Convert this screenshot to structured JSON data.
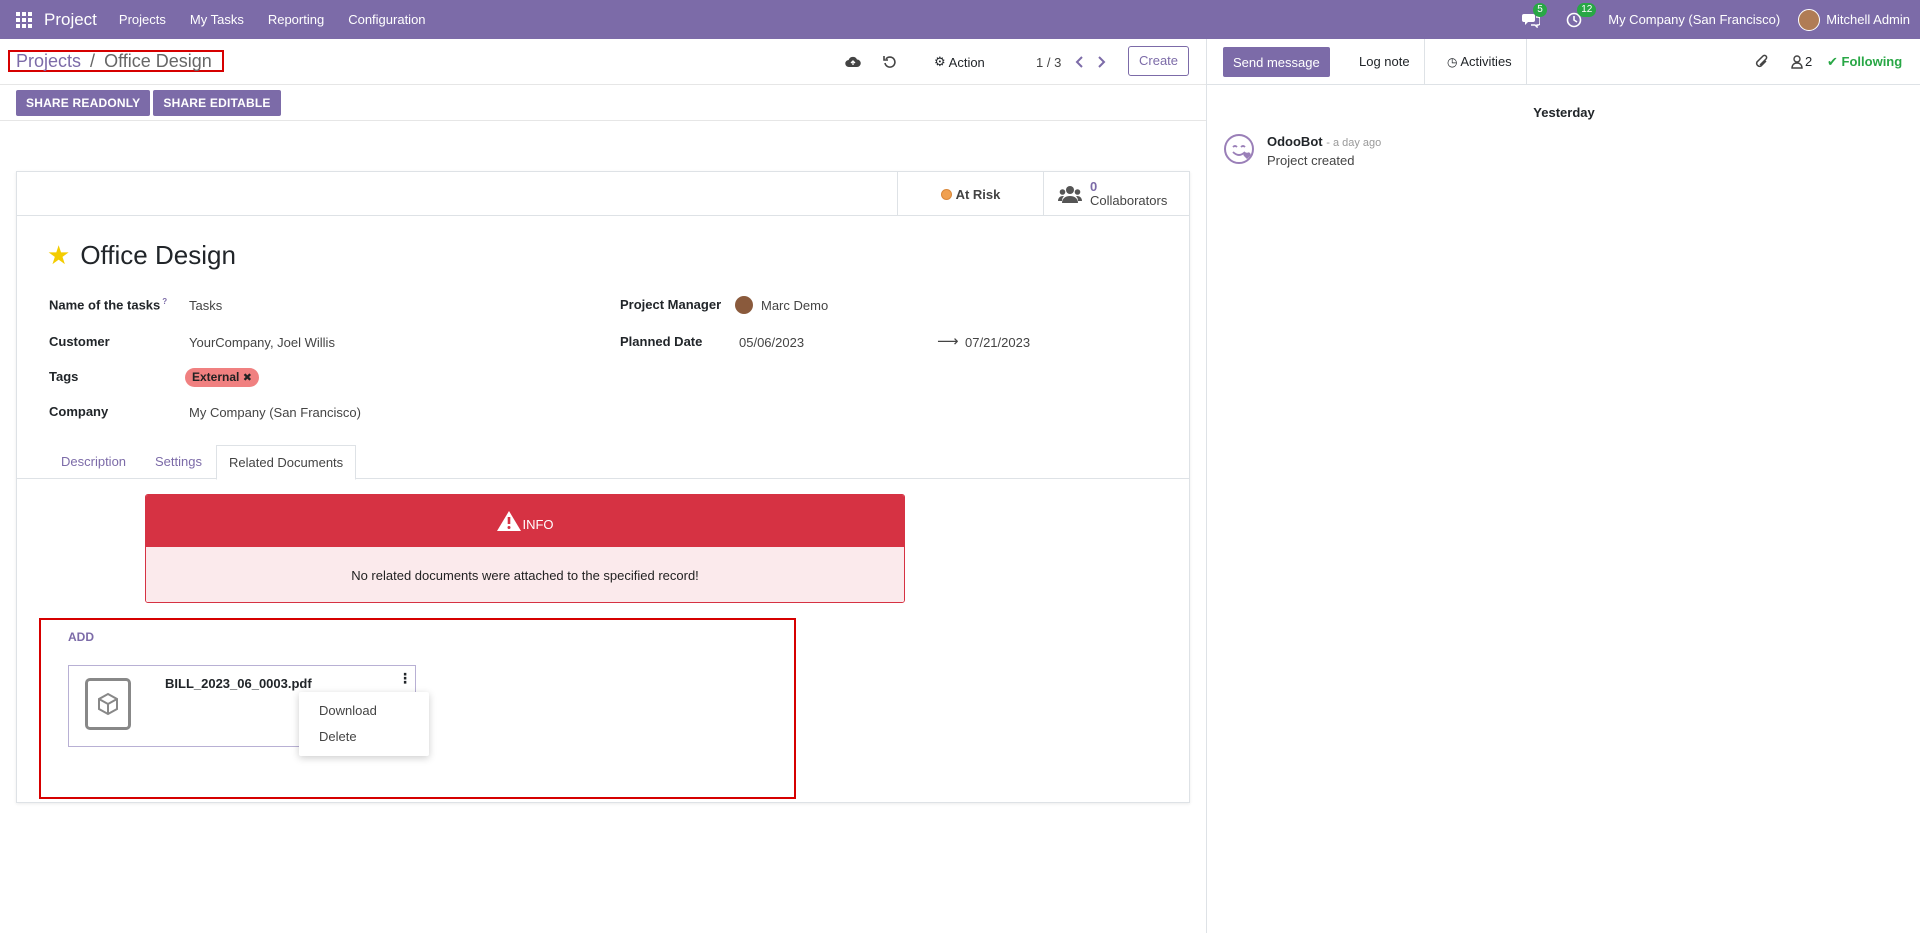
{
  "app": {
    "name": "Project"
  },
  "nav": {
    "items": [
      "Projects",
      "My Tasks",
      "Reporting",
      "Configuration"
    ]
  },
  "systray": {
    "messages_count": "5",
    "activities_count": "12",
    "company": "My Company (San Francisco)",
    "user": "Mitchell Admin"
  },
  "breadcrumb": {
    "parent": "Projects",
    "separator": "/",
    "current": "Office Design"
  },
  "control": {
    "action_label": "Action",
    "pager": "1 / 3",
    "create_label": "Create"
  },
  "share": {
    "readonly_label": "SHARE READONLY",
    "editable_label": "SHARE EDITABLE"
  },
  "smart_buttons": {
    "status_label": "At Risk",
    "collaborators_count": "0",
    "collaborators_label": "Collaborators"
  },
  "record": {
    "title": "Office Design",
    "fields": {
      "task_name_label": "Name of the tasks",
      "task_name_help": "?",
      "task_name_value": "Tasks",
      "customer_label": "Customer",
      "customer_value": "YourCompany, Joel Willis",
      "tags_label": "Tags",
      "tag_value": "External",
      "company_label": "Company",
      "company_value": "My Company (San Francisco)",
      "manager_label": "Project Manager",
      "manager_value": "Marc Demo",
      "planned_label": "Planned Date",
      "planned_start": "05/06/2023",
      "planned_end": "07/21/2023"
    }
  },
  "tabs": [
    "Description",
    "Settings",
    "Related Documents"
  ],
  "alert": {
    "title": "INFO",
    "message": "No related documents were attached to the specified record!"
  },
  "documents": {
    "add_label": "ADD",
    "file_name": "BILL_2023_06_0003.pdf",
    "menu": [
      "Download",
      "Delete"
    ]
  },
  "chatter": {
    "send_message": "Send message",
    "log_note": "Log note",
    "activities": "Activities",
    "followers_count": "2",
    "following_label": "Following",
    "date_separator": "Yesterday",
    "message": {
      "author": "OdooBot",
      "time": "- a day ago",
      "body": "Project created"
    }
  },
  "colors": {
    "brand": "#7c6ba8",
    "danger": "#d63243",
    "success": "#28a745",
    "tag": "#f08080"
  }
}
